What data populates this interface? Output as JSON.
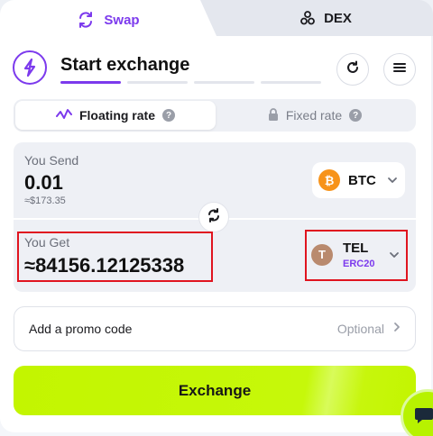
{
  "tabs": {
    "swap_label": "Swap",
    "dex_label": "DEX",
    "swap_icon": "swap-arrows-icon",
    "dex_icon": "nodes-icon"
  },
  "header": {
    "title": "Start exchange",
    "steps_total": 4,
    "steps_active": 1,
    "logo_icon": "lightning-icon"
  },
  "rate": {
    "floating_label": "Floating rate",
    "fixed_label": "Fixed rate",
    "selected": "floating",
    "help_glyph": "?"
  },
  "send": {
    "label": "You Send",
    "amount": "0.01",
    "usd": "≈$173.35",
    "coin": {
      "ticker": "BTC",
      "glyph": "₿",
      "color": "#f7931a"
    }
  },
  "get": {
    "label": "You Get",
    "amount": "≈84156.12125338",
    "coin": {
      "ticker": "TEL",
      "network": "ERC20",
      "glyph": "T",
      "color": "#b98a6e"
    }
  },
  "promo": {
    "label": "Add a promo code",
    "optional_label": "Optional"
  },
  "exchange": {
    "label": "Exchange"
  },
  "colors": {
    "accent": "#7c3aed",
    "cta": "#c3f500",
    "highlight": "#e0141f"
  }
}
